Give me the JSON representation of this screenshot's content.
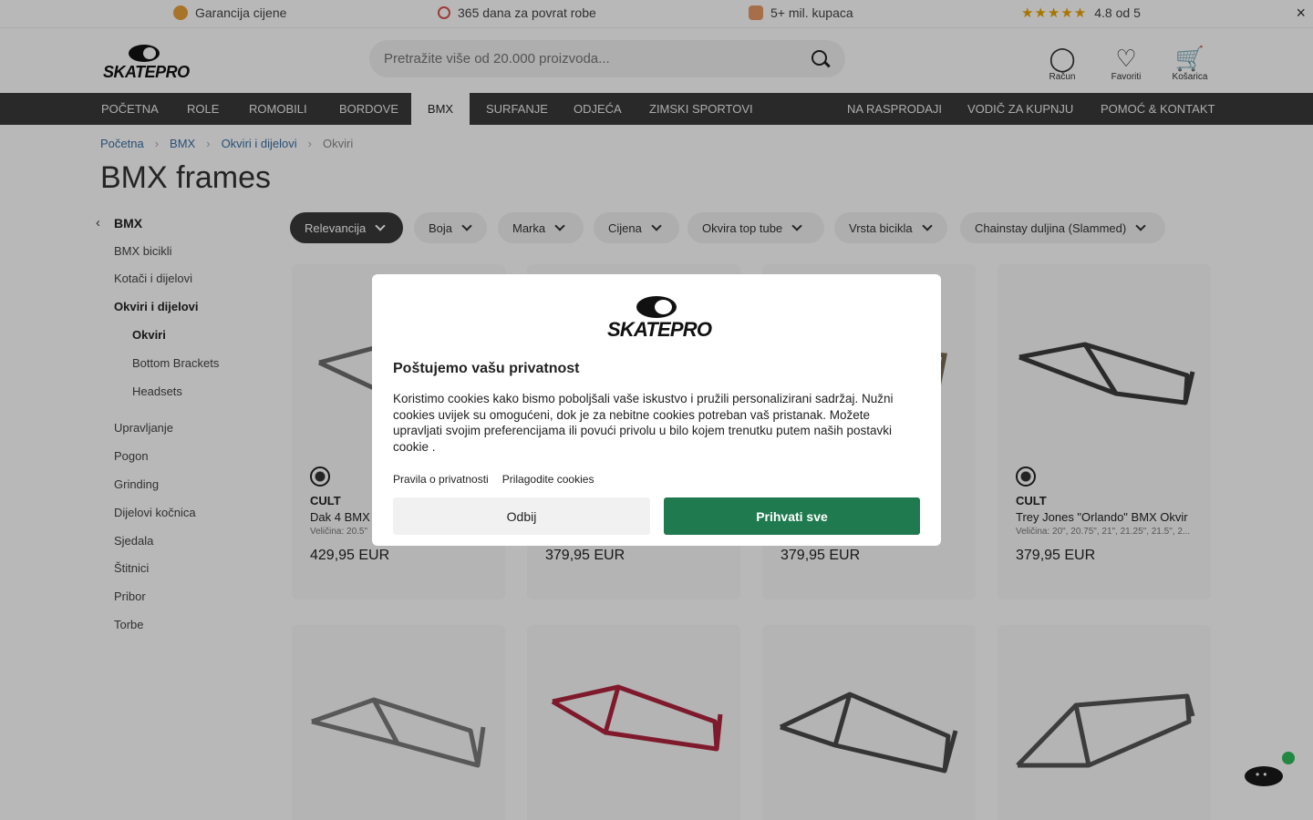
{
  "usp": {
    "price_guarantee": "Garancija cijene",
    "returns": "365 dana za povrat robe",
    "customers": "5+ mil. kupaca",
    "rating_stars": "★★★★★",
    "rating_text": "4.8 od 5",
    "close": "×"
  },
  "header": {
    "logo_text": "SKATEPRO",
    "search_placeholder": "Pretražite više od 20.000 proizvoda...",
    "account_label": "Račun",
    "favorites_label": "Favoriti",
    "cart_label": "Košarica"
  },
  "nav": {
    "items": [
      "POČETNA",
      "ROLE",
      "ROMOBILI",
      "BORDOVE",
      "BMX",
      "SURFANJE",
      "ODJEĆA",
      "ZIMSKI SPORTOVI",
      "NA RASPRODAJI",
      "VODIČ ZA KUPNJU",
      "POMOĆ & KONTAKT"
    ],
    "active": "BMX"
  },
  "breadcrumb": [
    "Početna",
    "BMX",
    "Okviri i dijelovi",
    "Okviri"
  ],
  "breadcrumb_sep": "›",
  "page_title": "BMX frames",
  "sidebar": {
    "parent": "BMX",
    "back_glyph": "‹",
    "items": [
      "BMX bicikli",
      "Kotači i dijelovi",
      "Okviri i dijelovi",
      "Okviri",
      "Bottom Brackets",
      "Headsets",
      "Upravljanje",
      "Pogon",
      "Grinding",
      "Dijelovi kočnica",
      "Sjedala",
      "Štitnici",
      "Pribor",
      "Torbe"
    ]
  },
  "filters": [
    "Relevancija",
    "Boja",
    "Marka",
    "Cijena",
    "Okvira top tube",
    "Vrsta bicikla",
    "Chainstay duljina (Slammed)"
  ],
  "products": [
    {
      "brand": "CULT",
      "name": "Dak 4 BMX Okvir",
      "size": "Veličina: 20.5\"",
      "price": "429,95 EUR",
      "frame_color": "#6e6e6e"
    },
    {
      "brand": "",
      "name": "",
      "size": "",
      "price": "379,95 EUR",
      "frame_color": "#6e6e6e"
    },
    {
      "brand": "",
      "name": "",
      "size": "",
      "price": "379,95 EUR",
      "frame_color": "#7a6a55"
    },
    {
      "brand": "CULT",
      "name": "Trey Jones \"Orlando\" BMX Okvir",
      "size": "Veličina: 20\", 20.75\", 21\", 21.25\", 21.5\", 2...",
      "price": "379,95 EUR",
      "frame_color": "#3c3c3c"
    },
    {
      "frame_color": "#7b7b7b"
    },
    {
      "frame_color": "#b0243f"
    },
    {
      "frame_color": "#4a4a4a"
    },
    {
      "frame_color": "#555555"
    }
  ],
  "cookie_modal": {
    "logo_text": "SKATEPRO",
    "title": "Poštujemo vašu privatnost",
    "body": "Koristimo cookies kako bismo poboljšali vaše iskustvo i pružili personalizirani sadržaj. Nužni cookies uvijek su omogućeni, dok je za nebitne cookies potreban vaš pristanak. Možete upravljati svojim preferencijama ili povući privolu u bilo kojem trenutku putem naših postavki cookie .",
    "privacy_link": "Pravila o privatnosti",
    "customize_link": "Prilagodite cookies",
    "deny_label": "Odbij",
    "accept_label": "Prihvati sve",
    "accept_color": "#1f7a4f"
  }
}
